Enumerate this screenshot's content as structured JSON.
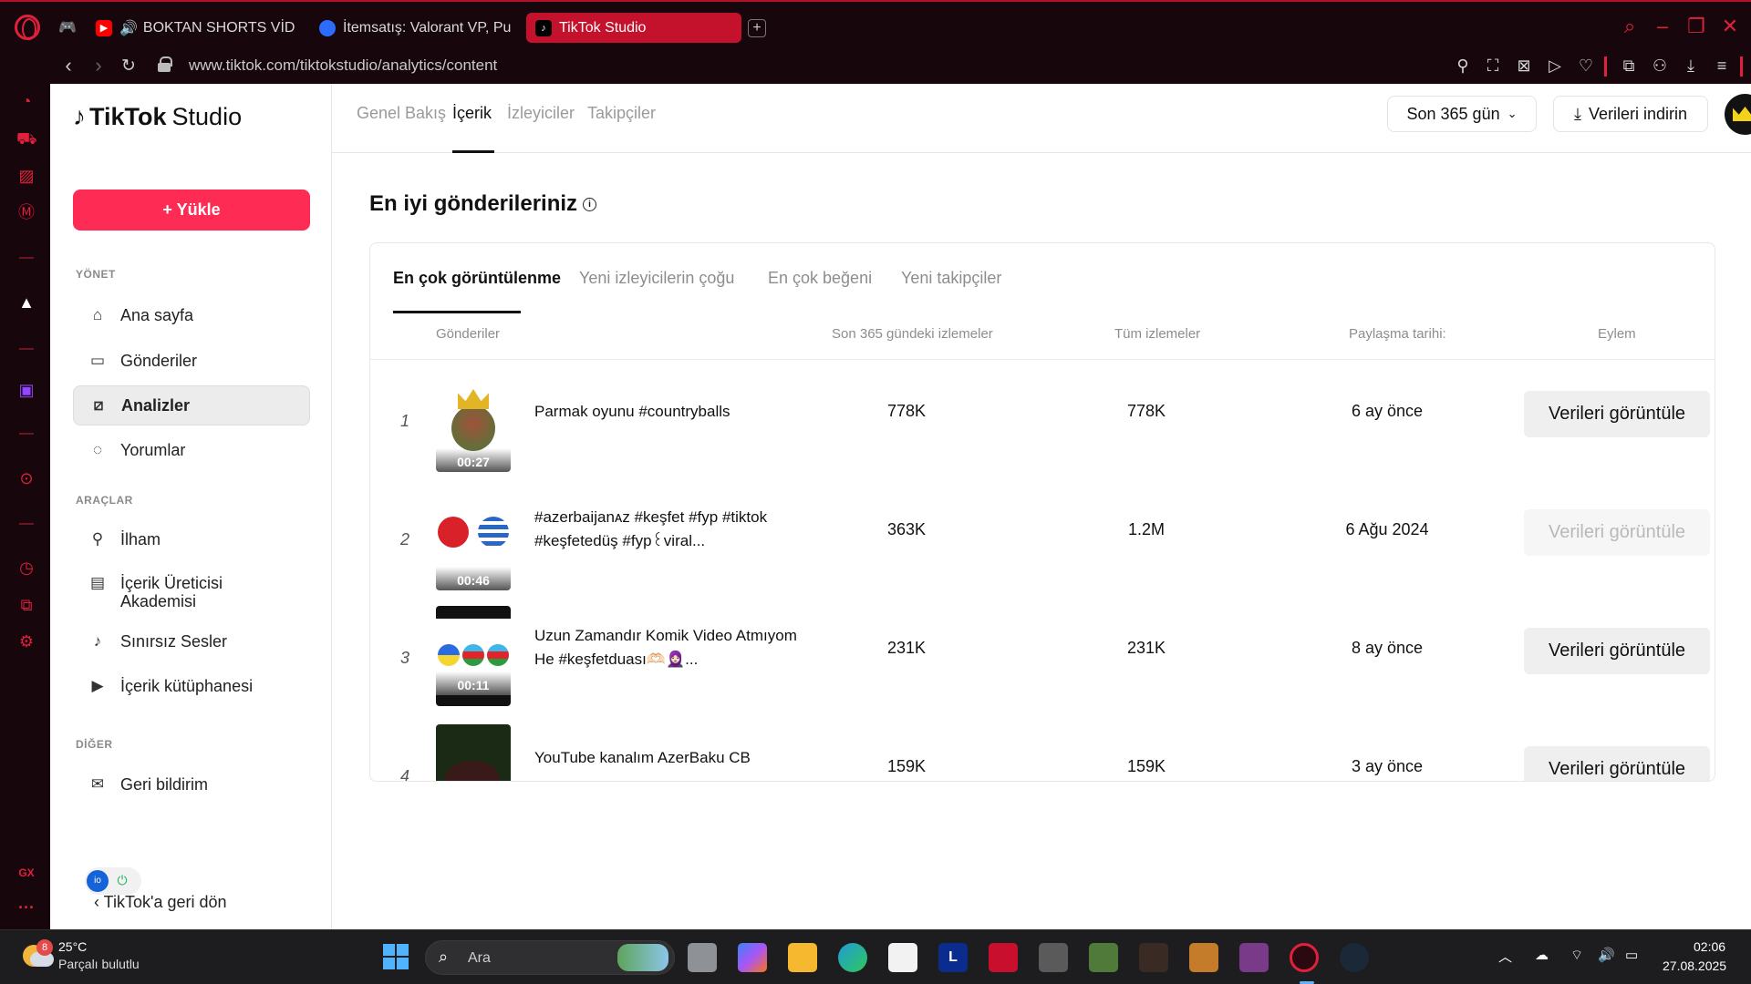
{
  "browser": {
    "tabs": [
      {
        "label": "BOKTAN SHORTS VİD",
        "icon": "youtube-icon",
        "color": "#ff0000"
      },
      {
        "label": "İtemsatış: Valorant VP, Pu",
        "icon": "itemsatis-icon",
        "color": "#2b6cff"
      },
      {
        "label": "TikTok Studio",
        "icon": "tiktok-icon",
        "color": "#000000"
      }
    ],
    "new_tab": "+",
    "url": "www.tiktok.com/tiktokstudio/analytics/content",
    "accent_color": "#e0203c"
  },
  "gx_sidebar": {
    "bottom_label": "GX",
    "more": "···"
  },
  "sidebar": {
    "logo_main": "TikTok",
    "logo_sub": "Studio",
    "upload_label": "+ Yükle",
    "sections": {
      "manage": "YÖNET",
      "tools": "ARAÇLAR",
      "other": "DİĞER"
    },
    "items": [
      {
        "label": "Ana sayfa",
        "icon": "home-icon"
      },
      {
        "label": "Gönderiler",
        "icon": "posts-icon"
      },
      {
        "label": "Analizler",
        "icon": "analytics-icon"
      },
      {
        "label": "Yorumlar",
        "icon": "comments-icon"
      },
      {
        "label": "İlham",
        "icon": "lightbulb-icon"
      },
      {
        "label": "İçerik Üreticisi\nAkademisi",
        "icon": "academy-icon"
      },
      {
        "label": "Sınırsız Sesler",
        "icon": "music-icon"
      },
      {
        "label": "İçerik kütüphanesi",
        "icon": "library-icon"
      },
      {
        "label": "Geri bildirim",
        "icon": "feedback-icon"
      }
    ],
    "back_label": "TikTok'a geri dön"
  },
  "topnav": {
    "tabs": [
      "Genel Bakış",
      "İçerik",
      "İzleyiciler",
      "Takipçiler"
    ],
    "active_tab": "İçerik",
    "range_label": "Son 365 gün",
    "download_label": "Verileri indirin"
  },
  "main": {
    "heading": "En iyi gönderileriniz",
    "card_tabs": [
      "En çok görüntülenme",
      "Yeni izleyicilerin çoğu",
      "En çok beğeni",
      "Yeni takipçiler"
    ],
    "columns": [
      "Gönderiler",
      "Son 365 gündeki izlemeler",
      "Tüm izlemeler",
      "Paylaşma tarihi:",
      "Eylem"
    ],
    "rows": [
      {
        "rank": "1",
        "duration": "00:27",
        "title": "Parmak oyunu #countryballs",
        "views_365": "778K",
        "views_all": "778K",
        "date": "6 ay önce",
        "action": "Verileri görüntüle",
        "disabled": false
      },
      {
        "rank": "2",
        "duration": "00:46",
        "title": "#azerbaijanᴀᴢ #keşfet #fyp #tiktok #keşfetedüş #fyp꒰viral...",
        "views_365": "363K",
        "views_all": "1.2M",
        "date": "6 Ağu 2024",
        "action": "Verileri görüntüle",
        "disabled": true
      },
      {
        "rank": "3",
        "duration": "00:11",
        "title": "Uzun Zamandır Komik Video Atmıyom He #keşfetduası🫶🏻🧕🏻...",
        "views_365": "231K",
        "views_all": "231K",
        "date": "8 ay önce",
        "action": "Verileri görüntüle",
        "disabled": false
      },
      {
        "rank": "4",
        "duration": "",
        "title": "YouTube kanalım AzerBaku CB",
        "views_365": "159K",
        "views_all": "159K",
        "date": "3 ay önce",
        "action": "Verileri görüntüle",
        "disabled": false
      }
    ]
  },
  "taskbar": {
    "weather_temp": "25°C",
    "weather_desc": "Parçalı bulutlu",
    "weather_badge": "8",
    "search_label": "Ara",
    "time": "02:06",
    "date": "27.08.2025"
  }
}
